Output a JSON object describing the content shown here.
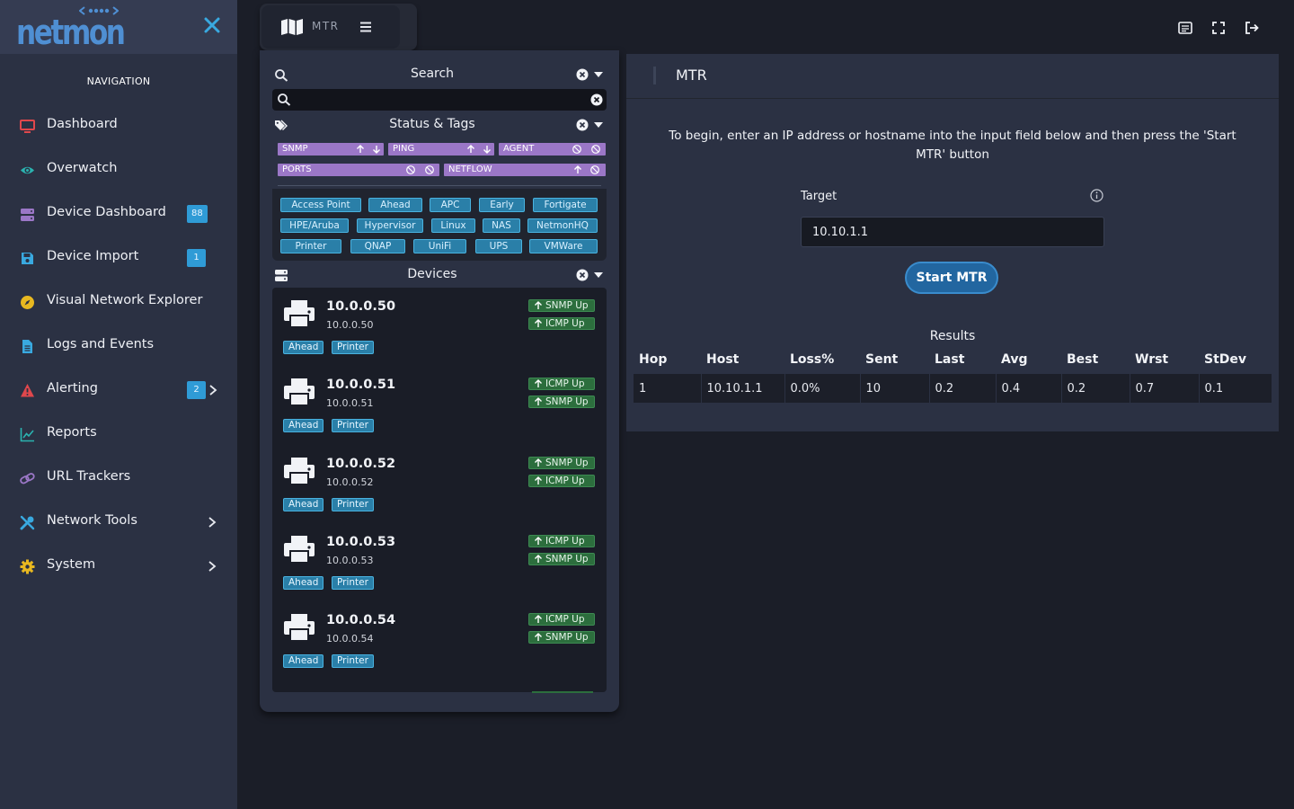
{
  "app": {
    "logo_text": "netmon"
  },
  "sidebar": {
    "title": "NAVIGATION",
    "items": [
      {
        "label": "Dashboard",
        "icon": "monitor-icon",
        "color": "#e0474c"
      },
      {
        "label": "Overwatch",
        "icon": "eye-icon",
        "color": "#2bb3b0"
      },
      {
        "label": "Device Dashboard",
        "icon": "server-icon",
        "color": "#9b77c7",
        "badge": "88"
      },
      {
        "label": "Device Import",
        "icon": "floppy-icon",
        "color": "#39a9e0",
        "badge": "1"
      },
      {
        "label": "Visual Network Explorer",
        "icon": "compass-icon",
        "color": "#e8b820"
      },
      {
        "label": "Logs and Events",
        "icon": "file-icon",
        "color": "#39a9e0"
      },
      {
        "label": "Alerting",
        "icon": "warning-icon",
        "color": "#e0474c",
        "badge": "2"
      },
      {
        "label": "Reports",
        "icon": "chart-line-icon",
        "color": "#2bb3b0"
      },
      {
        "label": "URL Trackers",
        "icon": "link-icon",
        "color": "#9b77c7"
      },
      {
        "label": "Network Tools",
        "icon": "tools-icon",
        "color": "#39a9e0"
      },
      {
        "label": "System",
        "icon": "gear-icon",
        "color": "#e8b820"
      }
    ]
  },
  "tab": {
    "label": "MTR"
  },
  "panel": {
    "search_title": "Search",
    "search_value": "",
    "status_title": "Status & Tags",
    "pills": [
      "SNMP",
      "PING",
      "AGENT",
      "PORTS",
      "NETFLOW"
    ],
    "tags": [
      "Access Point",
      "Ahead",
      "APC",
      "Early",
      "Fortigate",
      "HPE/Aruba",
      "Hypervisor",
      "Linux",
      "NAS",
      "NetmonHQ",
      "Printer",
      "QNAP",
      "UniFi",
      "UPS",
      "VMWare"
    ],
    "devices_title": "Devices",
    "devices": [
      {
        "name": "10.0.0.50",
        "ip": "10.0.0.50",
        "tags": [
          "Ahead",
          "Printer"
        ],
        "status": [
          "SNMP Up",
          "ICMP Up"
        ]
      },
      {
        "name": "10.0.0.51",
        "ip": "10.0.0.51",
        "tags": [
          "Ahead",
          "Printer"
        ],
        "status": [
          "ICMP Up",
          "SNMP Up"
        ]
      },
      {
        "name": "10.0.0.52",
        "ip": "10.0.0.52",
        "tags": [
          "Ahead",
          "Printer"
        ],
        "status": [
          "SNMP Up",
          "ICMP Up"
        ]
      },
      {
        "name": "10.0.0.53",
        "ip": "10.0.0.53",
        "tags": [
          "Ahead",
          "Printer"
        ],
        "status": [
          "ICMP Up",
          "SNMP Up"
        ]
      },
      {
        "name": "10.0.0.54",
        "ip": "10.0.0.54",
        "tags": [
          "Ahead",
          "Printer"
        ],
        "status": [
          "ICMP Up",
          "SNMP Up"
        ]
      }
    ]
  },
  "mtr": {
    "title": "MTR",
    "instructions": "To begin, enter an IP address or hostname into the input field below and then press the 'Start MTR' button",
    "target_label": "Target",
    "target_value": "10.10.1.1",
    "start_label": "Start MTR",
    "results_title": "Results",
    "columns": [
      "Hop",
      "Host",
      "Loss%",
      "Sent",
      "Last",
      "Avg",
      "Best",
      "Wrst",
      "StDev"
    ],
    "rows": [
      [
        "1",
        "10.10.1.1",
        "0.0%",
        "10",
        "0.2",
        "0.4",
        "0.2",
        "0.7",
        "0.1"
      ]
    ]
  },
  "colors": {
    "accent": "#2f9bd6",
    "pill": "#9b77c7",
    "tag": "#2a7fa8",
    "status_up": "#2c6e3d",
    "sidebar_bg": "#2b3143"
  }
}
